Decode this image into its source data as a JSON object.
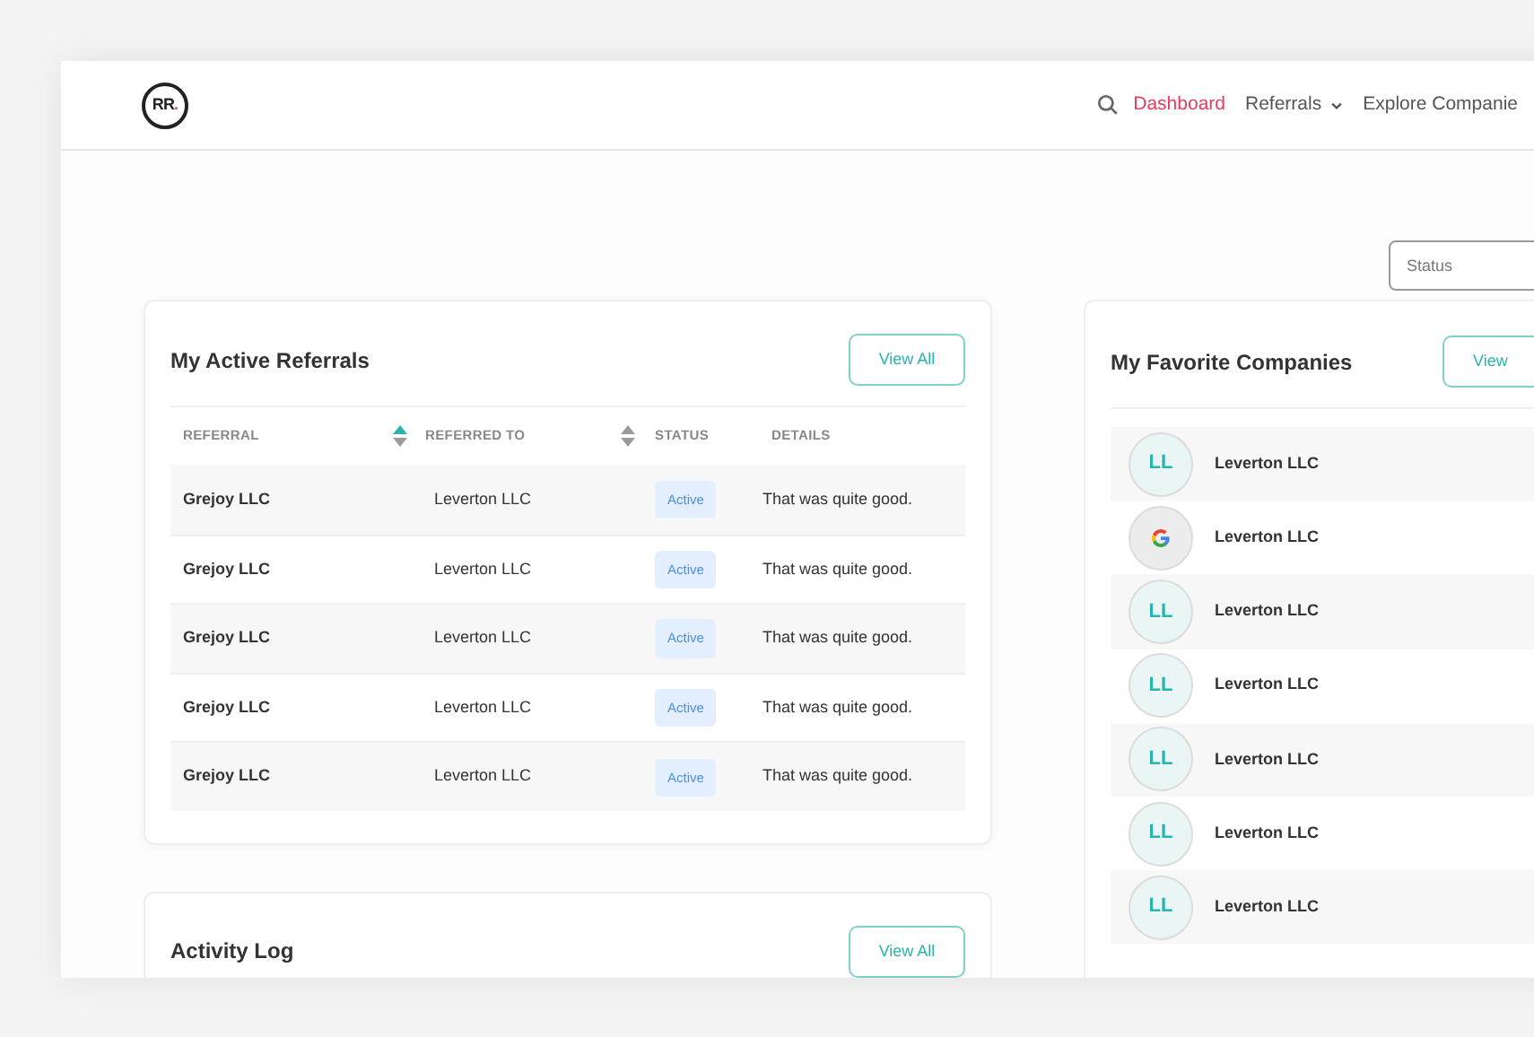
{
  "header": {
    "logo": "RR",
    "logo_dot": ".",
    "nav": [
      {
        "label": "Dashboard",
        "selected": true,
        "dropdown": false
      },
      {
        "label": "Referrals",
        "selected": false,
        "dropdown": true
      },
      {
        "label": "Explore Companie",
        "selected": false,
        "dropdown": false
      }
    ]
  },
  "status_filter": {
    "placeholder": "Status"
  },
  "referrals": {
    "title": "My Active Referrals",
    "button": "View All",
    "columns": [
      {
        "label": "REFERRAL",
        "sorted": true
      },
      {
        "label": "REFERRED TO",
        "sorted": false
      },
      {
        "label": "STATUS"
      },
      {
        "label": "DETAILS"
      }
    ],
    "rows": [
      {
        "referral": "Grejoy LLC",
        "referred_to": "Leverton LLC",
        "status": "Active",
        "details": "That was quite good."
      },
      {
        "referral": "Grejoy LLC",
        "referred_to": "Leverton LLC",
        "status": "Active",
        "details": "That was quite good."
      },
      {
        "referral": "Grejoy LLC",
        "referred_to": "Leverton LLC",
        "status": "Active",
        "details": "That was quite good."
      },
      {
        "referral": "Grejoy LLC",
        "referred_to": "Leverton LLC",
        "status": "Active",
        "details": "That was quite good."
      },
      {
        "referral": "Grejoy LLC",
        "referred_to": "Leverton LLC",
        "status": "Active",
        "details": "That was quite good."
      }
    ]
  },
  "activity_log": {
    "title": "Activity Log",
    "button": "View All"
  },
  "favorites": {
    "title": "My Favorite Companies",
    "button": "View",
    "items": [
      {
        "kind": "initials",
        "initials": "LL",
        "name": "Leverton LLC"
      },
      {
        "kind": "logo",
        "name": "Leverton LLC"
      },
      {
        "kind": "initials",
        "initials": "LL",
        "name": "Leverton LLC"
      },
      {
        "kind": "initials",
        "initials": "LL",
        "name": "Leverton LLC"
      },
      {
        "kind": "initials",
        "initials": "LL",
        "name": "Leverton LLC"
      },
      {
        "kind": "initials",
        "initials": "LL",
        "name": "Leverton LLC"
      },
      {
        "kind": "initials",
        "initials": "LL",
        "name": "Leverton LLC"
      }
    ]
  }
}
